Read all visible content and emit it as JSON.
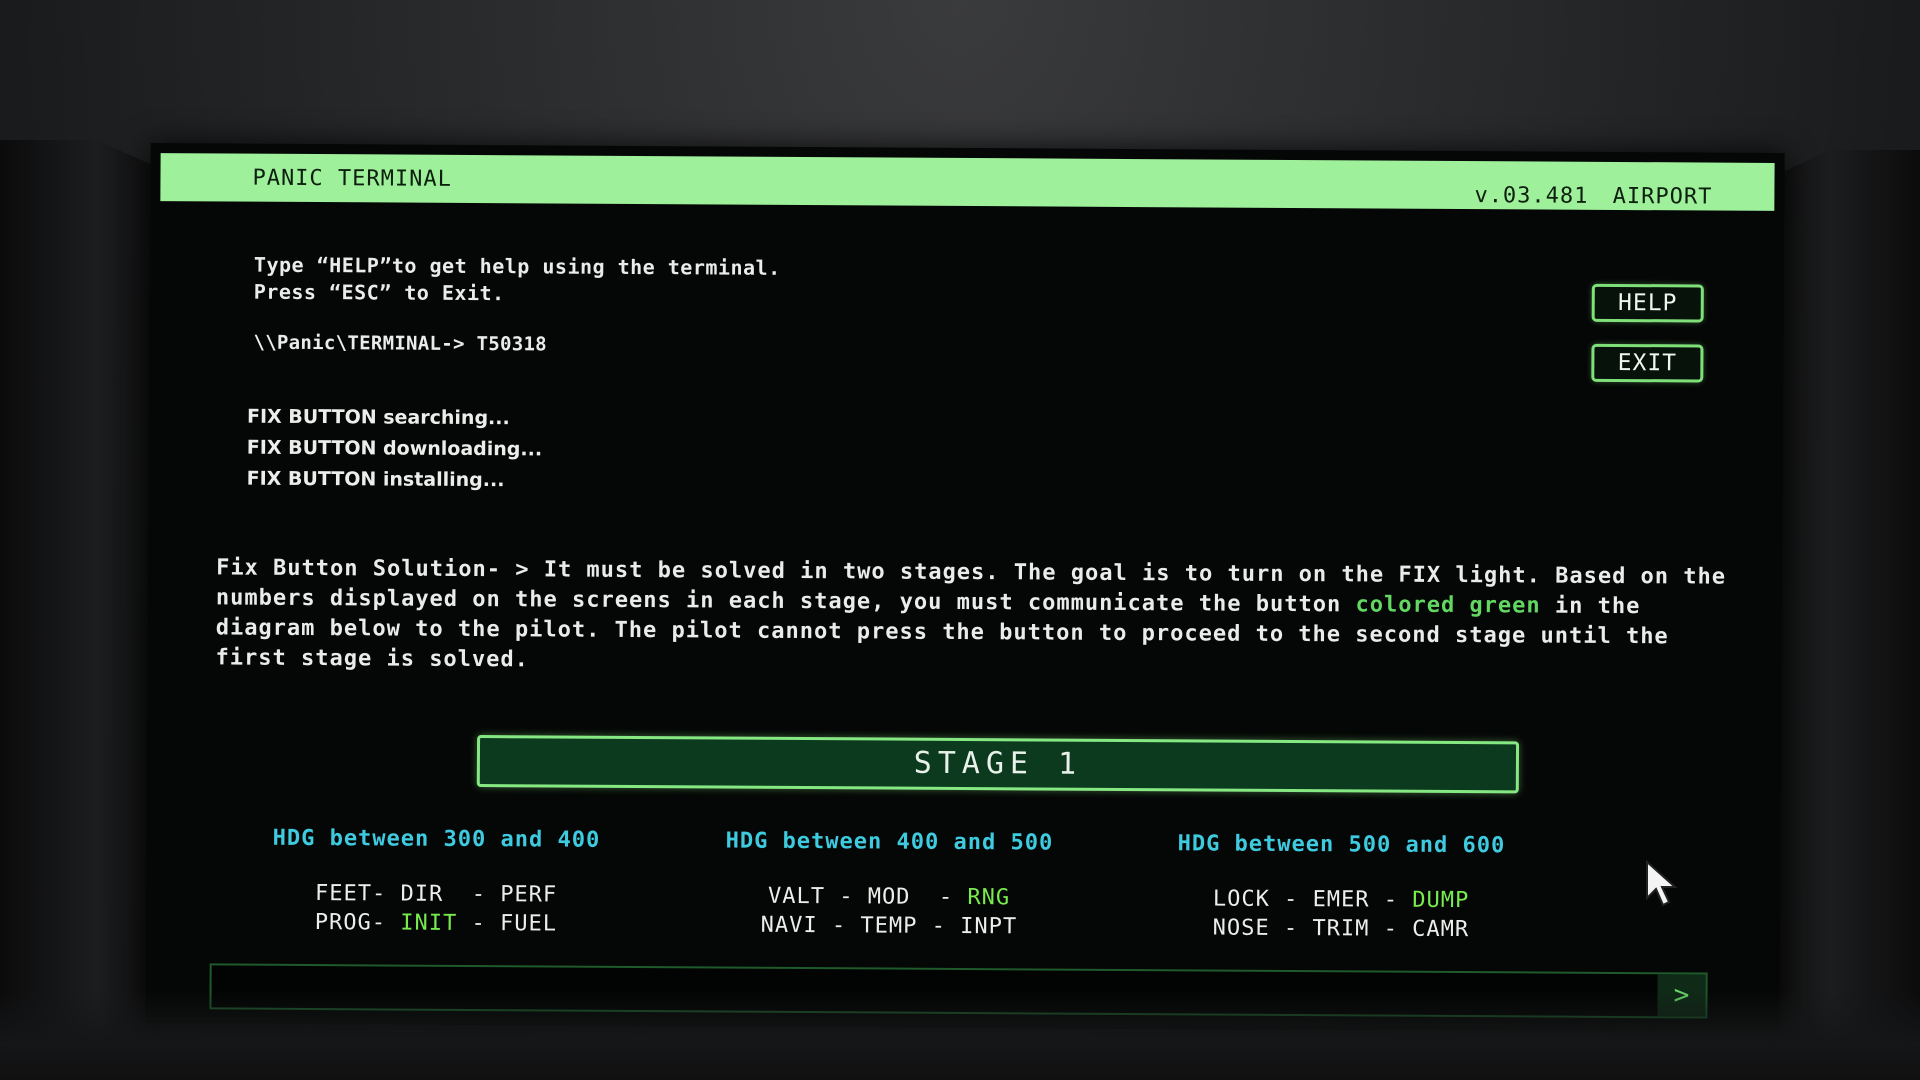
{
  "titlebar": {
    "title": "PANIC TERMINAL",
    "version": "v.03.481 AIRPORT"
  },
  "intro": {
    "line1": "Type “HELP”to get help using the terminal.",
    "line2": "Press “ESC” to Exit."
  },
  "prompt": "\\\\Panic\\TERMINAL-> T50318",
  "logs": [
    "FIX BUTTON searching...",
    "FIX BUTTON downloading...",
    "FIX BUTTON installing..."
  ],
  "buttons": {
    "help": "HELP",
    "exit": "EXIT"
  },
  "solution": {
    "part1": "Fix Button Solution- > It must be solved in two stages. The goal is to turn on the FIX light. Based on the numbers displayed on the screens in each stage, you must communicate the button ",
    "highlight": "colored green",
    "part2": " in the diagram below to the pilot. The pilot cannot press the button to proceed to the second stage until the first stage is solved."
  },
  "stage": {
    "title": "STAGE 1"
  },
  "groups": [
    {
      "heading": "HDG between 300 and 400",
      "row1": {
        "a": "FEET",
        "s1": "- ",
        "b": "DIR",
        "s2": "  - ",
        "c": "PERF"
      },
      "row2": {
        "a": "PROG",
        "s1": "- ",
        "b": "INIT",
        "s2": " - ",
        "c": "FUEL"
      }
    },
    {
      "heading": "HDG between 400 and 500",
      "row1": {
        "a": "VALT",
        "s1": " - ",
        "b": "MOD",
        "s2": "  - ",
        "c": "RNG"
      },
      "row2": {
        "a": "NAVI",
        "s1": " - ",
        "b": "TEMP",
        "s2": " - ",
        "c": "INPT"
      }
    },
    {
      "heading": "HDG between 500 and 600",
      "row1": {
        "a": "LOCK",
        "s1": " - ",
        "b": "EMER",
        "s2": " - ",
        "c": "DUMP"
      },
      "row2": {
        "a": "NOSE",
        "s1": " - ",
        "b": "TRIM",
        "s2": " - ",
        "c": "CAMR"
      }
    }
  ],
  "input": {
    "value": "",
    "submit": ">"
  },
  "colors": {
    "titlebar": "#9ff09a",
    "accent_green": "#62d863",
    "highlight_green": "#78ec4e",
    "heading_cyan": "#3ecbe0",
    "stage_bg": "#0b3a1e"
  }
}
